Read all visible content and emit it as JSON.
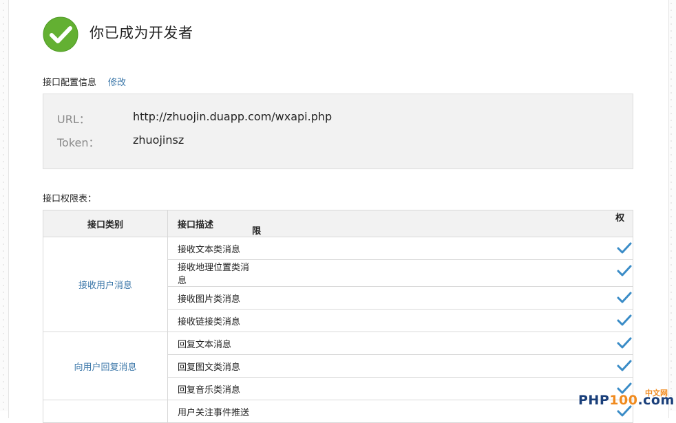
{
  "header": {
    "title": "你已成为开发者"
  },
  "config": {
    "section_label": "接口配置信息",
    "edit_label": "修改",
    "url_label": "URL：",
    "url_value": "http://zhuojin.duapp.com/wxapi.php",
    "token_label": "Token：",
    "token_value": "zhuojinsz"
  },
  "permissions": {
    "section_label": "接口权限表：",
    "headers": {
      "category": "接口类别",
      "description": "接口描述",
      "permission": "权限"
    },
    "groups": [
      {
        "category": "接收用户消息",
        "items": [
          "接收文本类消息",
          "接收地理位置类消息",
          "接收图片类消息",
          "接收链接类消息"
        ]
      },
      {
        "category": "向用户回复消息",
        "items": [
          "回复文本消息",
          "回复图文类消息",
          "回复音乐类消息"
        ]
      },
      {
        "category": "",
        "items": [
          "用户关注事件推送"
        ]
      }
    ]
  },
  "watermark": {
    "small": "中文网",
    "php": "PHP",
    "num": "100",
    "dot": ".com"
  },
  "colors": {
    "accent": "#3a76a8",
    "check": "#3a8cc7",
    "success": "#6cb33e"
  }
}
